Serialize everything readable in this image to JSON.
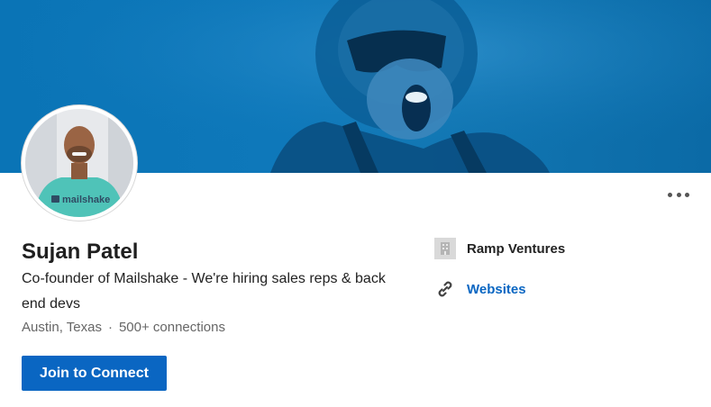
{
  "profile": {
    "name": "Sujan Patel",
    "headline": "Co-founder of Mailshake - We're hiring sales reps & back end devs",
    "location": "Austin, Texas",
    "separator": "·",
    "connections": "500+ connections",
    "connect_label": "Join to Connect",
    "avatar_shirt_text": "mailshake"
  },
  "sidebar": {
    "company_name": "Ramp Ventures",
    "websites_label": "Websites"
  },
  "icons": {
    "more": "more-horizontal-icon",
    "company": "building-icon",
    "websites": "link-icon"
  },
  "colors": {
    "banner": "#0e78ba",
    "accent": "#0a66c2",
    "text": "#1f1f1f",
    "muted": "#666666"
  }
}
